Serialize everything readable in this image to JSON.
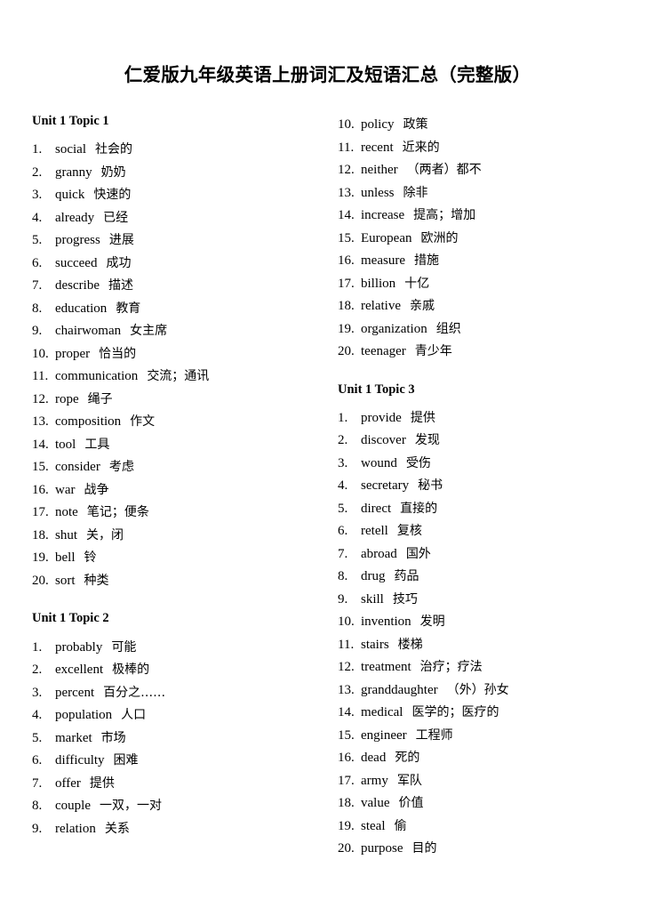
{
  "document": {
    "title": "仁爱版九年级英语上册词汇及短语汇总（完整版）"
  },
  "columns": {
    "left": {
      "sections": [
        {
          "heading": "Unit 1 Topic 1",
          "entries": [
            {
              "num": "1.",
              "word": "social",
              "gloss": "社会的"
            },
            {
              "num": "2.",
              "word": "granny",
              "gloss": "奶奶"
            },
            {
              "num": "3.",
              "word": "quick",
              "gloss": "快速的"
            },
            {
              "num": "4.",
              "word": "already",
              "gloss": "已经"
            },
            {
              "num": "5.",
              "word": "progress",
              "gloss": "进展"
            },
            {
              "num": "6.",
              "word": "succeed",
              "gloss": "成功"
            },
            {
              "num": "7.",
              "word": "describe",
              "gloss": "描述"
            },
            {
              "num": "8.",
              "word": "education",
              "gloss": "教育"
            },
            {
              "num": "9.",
              "word": "chairwoman",
              "gloss": "女主席"
            },
            {
              "num": "10.",
              "word": "proper",
              "gloss": "恰当的"
            },
            {
              "num": "11.",
              "word": "communication",
              "gloss": "交流；通讯"
            },
            {
              "num": "12.",
              "word": "rope",
              "gloss": "绳子"
            },
            {
              "num": "13.",
              "word": "composition",
              "gloss": "作文"
            },
            {
              "num": "14.",
              "word": "tool",
              "gloss": "工具"
            },
            {
              "num": "15.",
              "word": "consider",
              "gloss": "考虑"
            },
            {
              "num": "16.",
              "word": "war",
              "gloss": "战争"
            },
            {
              "num": "17.",
              "word": "note",
              "gloss": "笔记；便条"
            },
            {
              "num": "18.",
              "word": "shut",
              "gloss": "关，闭"
            },
            {
              "num": "19.",
              "word": "bell",
              "gloss": "铃"
            },
            {
              "num": "20.",
              "word": "sort",
              "gloss": "种类"
            }
          ]
        },
        {
          "heading": "Unit 1 Topic 2",
          "entries": [
            {
              "num": "1.",
              "word": "probably",
              "gloss": "可能"
            },
            {
              "num": "2.",
              "word": "excellent",
              "gloss": "极棒的"
            },
            {
              "num": "3.",
              "word": "percent",
              "gloss": "百分之……"
            },
            {
              "num": "4.",
              "word": "population",
              "gloss": "人口"
            },
            {
              "num": "5.",
              "word": "market",
              "gloss": "市场"
            },
            {
              "num": "6.",
              "word": "difficulty",
              "gloss": "困难"
            },
            {
              "num": "7.",
              "word": "offer",
              "gloss": "提供"
            },
            {
              "num": "8.",
              "word": "couple",
              "gloss": "一双，一对"
            },
            {
              "num": "9.",
              "word": "relation",
              "gloss": "关系"
            }
          ]
        }
      ]
    },
    "right": {
      "sections": [
        {
          "heading": "",
          "entries": [
            {
              "num": "10.",
              "word": "policy",
              "gloss": "政策"
            },
            {
              "num": "11.",
              "word": "recent",
              "gloss": "近来的"
            },
            {
              "num": "12.",
              "word": "neither",
              "gloss": "（两者）都不"
            },
            {
              "num": "13.",
              "word": "unless",
              "gloss": "除非"
            },
            {
              "num": "14.",
              "word": "increase",
              "gloss": "提高；增加"
            },
            {
              "num": "15.",
              "word": "European",
              "gloss": "欧洲的"
            },
            {
              "num": "16.",
              "word": "measure",
              "gloss": "措施"
            },
            {
              "num": "17.",
              "word": "billion",
              "gloss": "十亿"
            },
            {
              "num": "18.",
              "word": "relative",
              "gloss": "亲戚"
            },
            {
              "num": "19.",
              "word": "organization",
              "gloss": "组织"
            },
            {
              "num": "20.",
              "word": "teenager",
              "gloss": "青少年"
            }
          ]
        },
        {
          "heading": "Unit 1 Topic 3",
          "entries": [
            {
              "num": "1.",
              "word": "provide",
              "gloss": "提供"
            },
            {
              "num": "2.",
              "word": "discover",
              "gloss": "发现"
            },
            {
              "num": "3.",
              "word": "wound",
              "gloss": "受伤"
            },
            {
              "num": "4.",
              "word": "secretary",
              "gloss": "秘书"
            },
            {
              "num": "5.",
              "word": "direct",
              "gloss": "直接的"
            },
            {
              "num": "6.",
              "word": "retell",
              "gloss": "复核"
            },
            {
              "num": "7.",
              "word": "abroad",
              "gloss": "国外"
            },
            {
              "num": "8.",
              "word": "drug",
              "gloss": "药品"
            },
            {
              "num": "9.",
              "word": "skill",
              "gloss": "技巧"
            },
            {
              "num": "10.",
              "word": "invention",
              "gloss": "发明"
            },
            {
              "num": "11.",
              "word": "stairs",
              "gloss": "楼梯"
            },
            {
              "num": "12.",
              "word": "treatment",
              "gloss": "治疗；疗法"
            },
            {
              "num": "13.",
              "word": "granddaughter",
              "gloss": "（外）孙女"
            },
            {
              "num": "14.",
              "word": "medical",
              "gloss": "医学的；医疗的"
            },
            {
              "num": "15.",
              "word": "engineer",
              "gloss": "工程师"
            },
            {
              "num": "16.",
              "word": "dead",
              "gloss": "死的"
            },
            {
              "num": "17.",
              "word": "army",
              "gloss": "军队"
            },
            {
              "num": "18.",
              "word": "value",
              "gloss": "价值"
            },
            {
              "num": "19.",
              "word": "steal",
              "gloss": "偷"
            },
            {
              "num": "20.",
              "word": "purpose",
              "gloss": "目的"
            }
          ]
        }
      ]
    }
  }
}
